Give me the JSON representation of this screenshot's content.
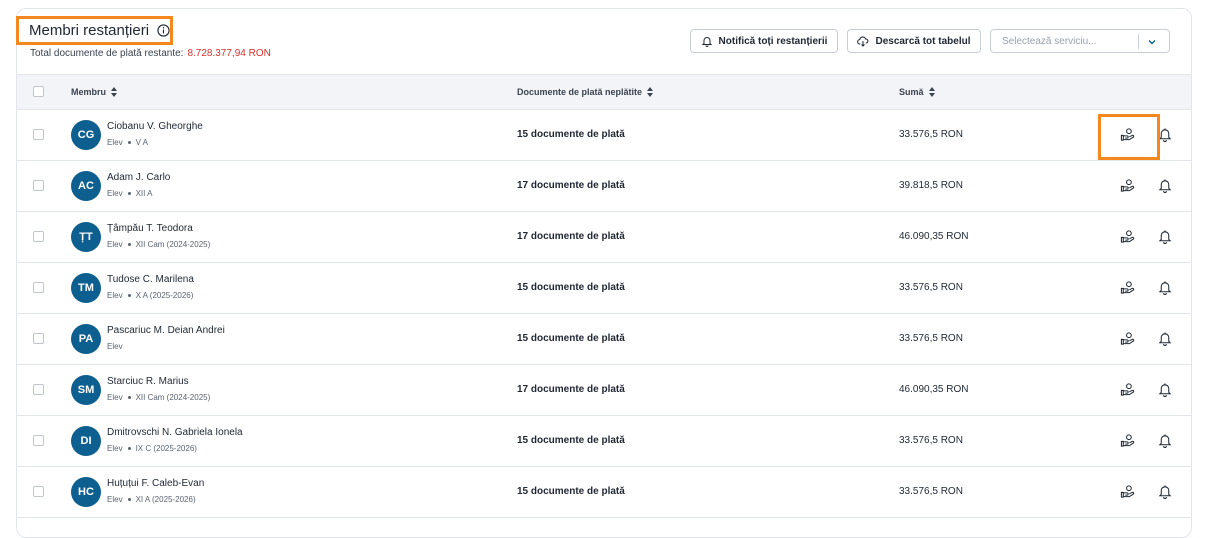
{
  "header": {
    "title": "Membri restanțieri",
    "subtitle_label": "Total documente de plată restante:",
    "subtitle_amount": "8.728.377,94 RON",
    "notify_all_label": "Notifică toți restanțierii",
    "download_label": "Descarcă tot tabelul",
    "service_select_placeholder": "Selectează serviciu..."
  },
  "table": {
    "columns": {
      "member": "Membru",
      "documents": "Documente de plată neplătite",
      "amount": "Sumă"
    },
    "rows": [
      {
        "initials": "CG",
        "name": "Ciobanu V. Gheorghe",
        "role": "Elev",
        "class": "V A",
        "documents": "15 documente de plată",
        "amount": "33.576,5 RON"
      },
      {
        "initials": "AC",
        "name": "Adam J. Carlo",
        "role": "Elev",
        "class": "XII A",
        "documents": "17 documente de plată",
        "amount": "39.818,5 RON"
      },
      {
        "initials": "ȚT",
        "name": "Țâmpău T. Teodora",
        "role": "Elev",
        "class": "XII Cam (2024-2025)",
        "documents": "17 documente de plată",
        "amount": "46.090,35 RON"
      },
      {
        "initials": "TM",
        "name": "Tudose C. Marilena",
        "role": "Elev",
        "class": "X A (2025-2026)",
        "documents": "15 documente de plată",
        "amount": "33.576,5 RON"
      },
      {
        "initials": "PA",
        "name": "Pascariuc M. Deian Andrei",
        "role": "Elev",
        "class": "",
        "documents": "15 documente de plată",
        "amount": "33.576,5 RON"
      },
      {
        "initials": "SM",
        "name": "Starciuc R. Marius",
        "role": "Elev",
        "class": "XII Cam (2024-2025)",
        "documents": "17 documente de plată",
        "amount": "46.090,35 RON"
      },
      {
        "initials": "DI",
        "name": "Dmitrovschi N. Gabriela Ionela",
        "role": "Elev",
        "class": "IX C (2025-2026)",
        "documents": "15 documente de plată",
        "amount": "33.576,5 RON"
      },
      {
        "initials": "HC",
        "name": "Huțuțui F. Caleb-Evan",
        "role": "Elev",
        "class": "XI A (2025-2026)",
        "documents": "15 documente de plată",
        "amount": "33.576,5 RON"
      }
    ]
  },
  "icons": {
    "info": "info-icon",
    "bell": "bell-icon",
    "cloud_download": "cloud-download-icon",
    "chevron": "chevron-down-icon",
    "sort": "sort-icon",
    "pay": "hand-money-icon"
  },
  "colors": {
    "accent": "#0d5f8f",
    "amount_red": "#d2322d",
    "highlight": "#f5871f"
  }
}
